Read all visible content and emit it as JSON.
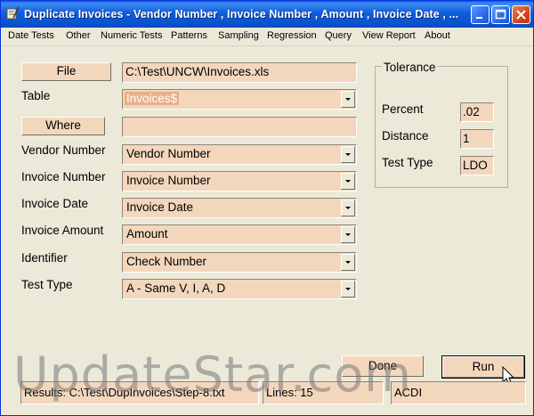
{
  "window": {
    "title": "Duplicate Invoices - Vendor Number , Invoice Number , Amount , Invoice Date , ...",
    "app_icon": "scroll-quill-icon",
    "controls": [
      "minimize-icon",
      "maximize-icon",
      "close-icon"
    ]
  },
  "menu": [
    "Date Tests",
    "Other",
    "Numeric Tests",
    "Patterns",
    "Sampling",
    "Regression",
    "Query",
    "View Report",
    "About"
  ],
  "form": {
    "file_button": "File",
    "file_path": "C:\\Test\\UNCW\\Invoices.xls",
    "table_label": "Table",
    "table_value": "Invoices$",
    "where_button": "Where",
    "where_value": "",
    "vendor_label": "Vendor Number",
    "vendor_value": "Vendor Number",
    "invoice_number_label": "Invoice Number",
    "invoice_number_value": "Invoice Number",
    "invoice_date_label": "Invoice Date",
    "invoice_date_value": "Invoice Date",
    "invoice_amount_label": "Invoice Amount",
    "invoice_amount_value": "Amount",
    "identifier_label": "Identifier",
    "identifier_value": "Check Number",
    "test_type_label": "Test Type",
    "test_type_value": "A - Same V, I, A, D"
  },
  "tolerance": {
    "title": "Tolerance",
    "percent_label": "Percent",
    "percent_value": ".02",
    "distance_label": "Distance",
    "distance_value": "1",
    "test_type_label": "Test Type",
    "test_type_value": "LDO"
  },
  "buttons": {
    "done": "Done",
    "run": "Run"
  },
  "status": {
    "results": "Results: C:\\Test\\DupInvoices\\Step-8.txt",
    "lines": "Lines: 15",
    "mode": "ACDI"
  },
  "watermark": "UpdateStar.com",
  "colors": {
    "field_bg": "#f3d7bd",
    "window_bg": "#ece9d8",
    "titlebar": "#0b54cf",
    "close_button": "#d4451f"
  }
}
